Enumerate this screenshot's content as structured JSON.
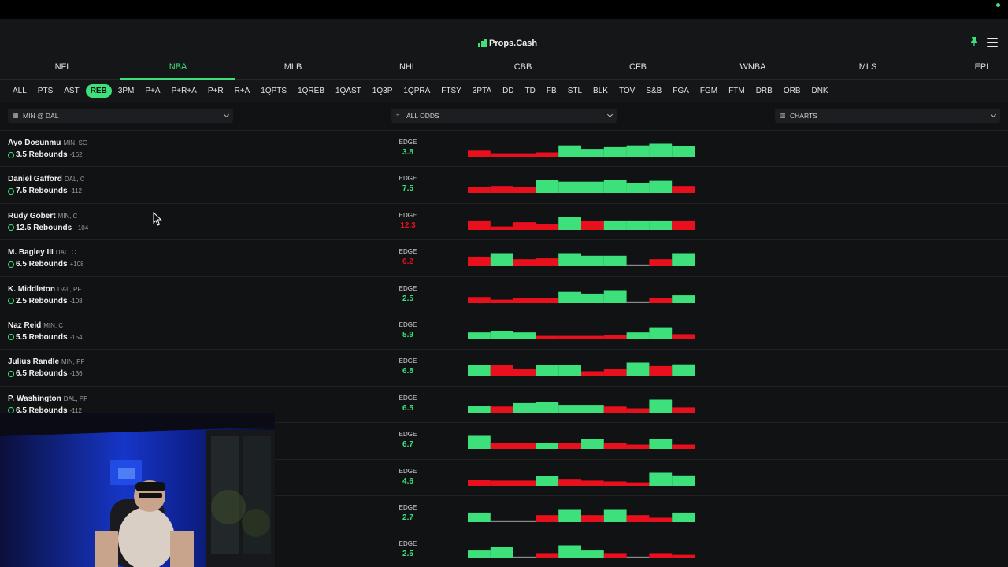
{
  "brand": {
    "name": "Props.Cash"
  },
  "icons": {
    "pin": "pin-icon",
    "menu": "hamburger-menu-icon",
    "calendar": "calendar-icon",
    "odds": "sort-icon",
    "charts": "bar-chart-icon"
  },
  "colors": {
    "accent": "#3ee07c",
    "hit": "#3ee07c",
    "miss": "#e8101d",
    "push": "#8a8a8a"
  },
  "sports": [
    {
      "label": "NFL",
      "active": false
    },
    {
      "label": "NBA",
      "active": true
    },
    {
      "label": "MLB",
      "active": false
    },
    {
      "label": "NHL",
      "active": false
    },
    {
      "label": "CBB",
      "active": false
    },
    {
      "label": "CFB",
      "active": false
    },
    {
      "label": "WNBA",
      "active": false
    },
    {
      "label": "MLS",
      "active": false
    },
    {
      "label": "EPL",
      "active": false
    }
  ],
  "markets": [
    "ALL",
    "PTS",
    "AST",
    "REB",
    "3PM",
    "P+A",
    "P+R+A",
    "P+R",
    "R+A",
    "1QPTS",
    "1QREB",
    "1QAST",
    "1Q3P",
    "1QPRA",
    "FTSY",
    "3PTA",
    "DD",
    "TD",
    "FB",
    "STL",
    "BLK",
    "TOV",
    "S&B",
    "FGA",
    "FGM",
    "FTM",
    "DRB",
    "ORB",
    "DNK"
  ],
  "active_market": "REB",
  "filters": {
    "game": "MIN @ DAL",
    "odds": "ALL ODDS",
    "view": "CHARTS"
  },
  "edge_label": "EDGE",
  "rows": [
    {
      "name": "Ayo Dosunmu",
      "meta": "MIN, SG",
      "line": "3.5 Rebounds",
      "odds": "-162",
      "edge": "3.8",
      "edge_positive": true,
      "history": [
        [
          "miss",
          0.35
        ],
        [
          "miss",
          0.2
        ],
        [
          "miss",
          0.2
        ],
        [
          "miss",
          0.25
        ],
        [
          "hit",
          0.65
        ],
        [
          "hit",
          0.45
        ],
        [
          "hit",
          0.55
        ],
        [
          "hit",
          0.65
        ],
        [
          "hit",
          0.75
        ],
        [
          "hit",
          0.6
        ]
      ]
    },
    {
      "name": "Daniel Gafford",
      "meta": "DAL, C",
      "line": "7.5 Rebounds",
      "odds": "-112",
      "edge": "7.5",
      "edge_positive": true,
      "history": [
        [
          "miss",
          0.35
        ],
        [
          "miss",
          0.4
        ],
        [
          "miss",
          0.35
        ],
        [
          "hit",
          0.75
        ],
        [
          "hit",
          0.65
        ],
        [
          "hit",
          0.65
        ],
        [
          "hit",
          0.75
        ],
        [
          "hit",
          0.55
        ],
        [
          "hit",
          0.7
        ],
        [
          "miss",
          0.4
        ]
      ]
    },
    {
      "name": "Rudy Gobert",
      "meta": "MIN, C",
      "line": "12.5 Rebounds",
      "odds": "+104",
      "edge": "12.3",
      "edge_positive": false,
      "history": [
        [
          "miss",
          0.55
        ],
        [
          "miss",
          0.2
        ],
        [
          "miss",
          0.45
        ],
        [
          "miss",
          0.35
        ],
        [
          "hit",
          0.75
        ],
        [
          "miss",
          0.5
        ],
        [
          "hit",
          0.55
        ],
        [
          "hit",
          0.55
        ],
        [
          "hit",
          0.55
        ],
        [
          "miss",
          0.55
        ]
      ]
    },
    {
      "name": "M. Bagley III",
      "meta": "DAL, C",
      "line": "6.5 Rebounds",
      "odds": "+108",
      "edge": "6.2",
      "edge_positive": false,
      "history": [
        [
          "miss",
          0.55
        ],
        [
          "hit",
          0.75
        ],
        [
          "miss",
          0.4
        ],
        [
          "miss",
          0.45
        ],
        [
          "hit",
          0.75
        ],
        [
          "hit",
          0.6
        ],
        [
          "hit",
          0.6
        ],
        [
          "push",
          0.1
        ],
        [
          "miss",
          0.4
        ],
        [
          "hit",
          0.75
        ]
      ]
    },
    {
      "name": "K. Middleton",
      "meta": "DAL, PF",
      "line": "2.5 Rebounds",
      "odds": "-108",
      "edge": "2.5",
      "edge_positive": true,
      "history": [
        [
          "miss",
          0.35
        ],
        [
          "miss",
          0.2
        ],
        [
          "miss",
          0.3
        ],
        [
          "miss",
          0.3
        ],
        [
          "hit",
          0.65
        ],
        [
          "hit",
          0.55
        ],
        [
          "hit",
          0.75
        ],
        [
          "push",
          0.1
        ],
        [
          "miss",
          0.3
        ],
        [
          "hit",
          0.45
        ]
      ]
    },
    {
      "name": "Naz Reid",
      "meta": "MIN, C",
      "line": "5.5 Rebounds",
      "odds": "-154",
      "edge": "5.9",
      "edge_positive": true,
      "history": [
        [
          "hit",
          0.4
        ],
        [
          "hit",
          0.5
        ],
        [
          "hit",
          0.4
        ],
        [
          "miss",
          0.2
        ],
        [
          "miss",
          0.2
        ],
        [
          "miss",
          0.2
        ],
        [
          "miss",
          0.25
        ],
        [
          "hit",
          0.4
        ],
        [
          "hit",
          0.7
        ],
        [
          "miss",
          0.3
        ]
      ]
    },
    {
      "name": "Julius Randle",
      "meta": "MIN, PF",
      "line": "6.5 Rebounds",
      "odds": "-136",
      "edge": "6.8",
      "edge_positive": true,
      "history": [
        [
          "hit",
          0.6
        ],
        [
          "miss",
          0.6
        ],
        [
          "miss",
          0.4
        ],
        [
          "hit",
          0.6
        ],
        [
          "hit",
          0.6
        ],
        [
          "miss",
          0.25
        ],
        [
          "miss",
          0.4
        ],
        [
          "hit",
          0.75
        ],
        [
          "miss",
          0.55
        ],
        [
          "hit",
          0.65
        ]
      ]
    },
    {
      "name": "P. Washington",
      "meta": "DAL, PF",
      "line": "6.5 Rebounds",
      "odds": "-112",
      "edge": "6.5",
      "edge_positive": true,
      "history": [
        [
          "hit",
          0.4
        ],
        [
          "miss",
          0.35
        ],
        [
          "hit",
          0.55
        ],
        [
          "hit",
          0.6
        ],
        [
          "hit",
          0.45
        ],
        [
          "hit",
          0.45
        ],
        [
          "miss",
          0.35
        ],
        [
          "miss",
          0.25
        ],
        [
          "hit",
          0.75
        ],
        [
          "miss",
          0.3
        ]
      ]
    },
    {
      "name": "",
      "meta": "",
      "line": "",
      "odds": "",
      "edge": "6.7",
      "edge_positive": true,
      "history": [
        [
          "hit",
          0.75
        ],
        [
          "miss",
          0.35
        ],
        [
          "miss",
          0.35
        ],
        [
          "hit",
          0.35
        ],
        [
          "miss",
          0.35
        ],
        [
          "hit",
          0.55
        ],
        [
          "miss",
          0.35
        ],
        [
          "miss",
          0.25
        ],
        [
          "hit",
          0.55
        ],
        [
          "miss",
          0.25
        ]
      ]
    },
    {
      "name": "",
      "meta": "",
      "line": "",
      "odds": "",
      "edge": "4.6",
      "edge_positive": true,
      "history": [
        [
          "miss",
          0.35
        ],
        [
          "miss",
          0.3
        ],
        [
          "miss",
          0.3
        ],
        [
          "hit",
          0.55
        ],
        [
          "miss",
          0.4
        ],
        [
          "miss",
          0.3
        ],
        [
          "miss",
          0.25
        ],
        [
          "miss",
          0.2
        ],
        [
          "hit",
          0.75
        ],
        [
          "hit",
          0.6
        ]
      ]
    },
    {
      "name": "",
      "meta": "",
      "line": "",
      "odds": "",
      "edge": "2.7",
      "edge_positive": true,
      "history": [
        [
          "hit",
          0.55
        ],
        [
          "push",
          0.1
        ],
        [
          "push",
          0.1
        ],
        [
          "miss",
          0.4
        ],
        [
          "hit",
          0.75
        ],
        [
          "miss",
          0.4
        ],
        [
          "hit",
          0.75
        ],
        [
          "miss",
          0.4
        ],
        [
          "miss",
          0.25
        ],
        [
          "hit",
          0.55
        ]
      ]
    },
    {
      "name": "",
      "meta": "",
      "line": "",
      "odds": "",
      "edge": "2.5",
      "edge_positive": true,
      "history": [
        [
          "hit",
          0.45
        ],
        [
          "hit",
          0.65
        ],
        [
          "push",
          0.1
        ],
        [
          "miss",
          0.3
        ],
        [
          "hit",
          0.75
        ],
        [
          "hit",
          0.45
        ],
        [
          "miss",
          0.3
        ],
        [
          "push",
          0.1
        ],
        [
          "miss",
          0.3
        ],
        [
          "miss",
          0.2
        ]
      ]
    }
  ]
}
